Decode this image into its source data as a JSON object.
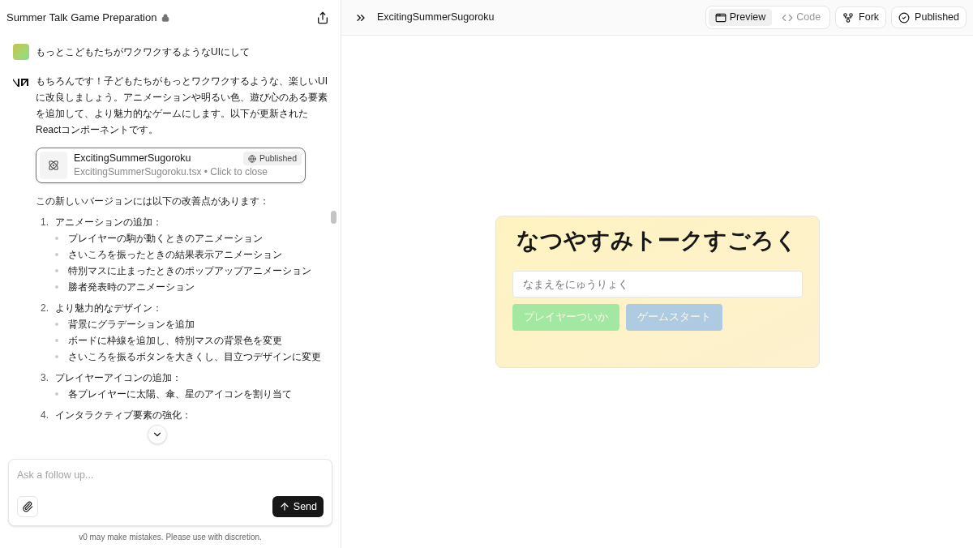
{
  "chat": {
    "title": "Summer Talk Game Preparation",
    "user_message": "もっとこどもたちがワクワクするようなUIにして",
    "assistant_intro": "もちろんです！子どもたちがもっとワクワクするような、楽しいUIに改良しましょう。アニメーションや明るい色、遊び心のある要素を追加して、より魅力的なゲームにします。以下が更新されたReactコンポーネントです。",
    "artifact": {
      "name": "ExcitingSummerSugoroku",
      "subtitle": "ExcitingSummerSugoroku.tsx • Click to close",
      "badge": "Published"
    },
    "lead": "この新しいバージョンには以下の改善点があります：",
    "list": [
      {
        "number": "1.",
        "title": "アニメーションの追加：",
        "bullets": [
          "プレイヤーの駒が動くときのアニメーション",
          "さいころを振ったときの結果表示アニメーション",
          "特別マスに止まったときのポップアップアニメーション",
          "勝者発表時のアニメーション"
        ]
      },
      {
        "number": "2.",
        "title": "より魅力的なデザイン：",
        "bullets": [
          "背景にグラデーションを追加",
          "ボードに枠線を追加し、特別マスの背景色を変更",
          "さいころを振るボタンを大きくし、目立つデザインに変更"
        ]
      },
      {
        "number": "3.",
        "title": "プレイヤーアイコンの追加：",
        "bullets": [
          "各プレイヤーに太陽、傘、星のアイコンを割り当て"
        ]
      },
      {
        "number": "4.",
        "title": "インタラクティブ要素の強化："
      }
    ],
    "input": {
      "placeholder": "Ask a follow up..."
    },
    "send": "Send",
    "disclaimer": "v0 may make mistakes. Please use with discretion."
  },
  "preview": {
    "title": "ExcitingSummerSugoroku",
    "tabs": [
      {
        "label": "Preview",
        "selected": true
      },
      {
        "label": "Code",
        "selected": false
      }
    ],
    "fork": "Fork",
    "published": "Published",
    "game": {
      "title": "なつやすみトークすごろく",
      "name_field": {
        "placeholder": "なまえをにゅうりょく"
      },
      "buttons": [
        {
          "label": "プレイヤーついか",
          "kind": "add",
          "disabled": true
        },
        {
          "label": "ゲームスタート",
          "kind": "start",
          "disabled": true
        }
      ]
    }
  }
}
